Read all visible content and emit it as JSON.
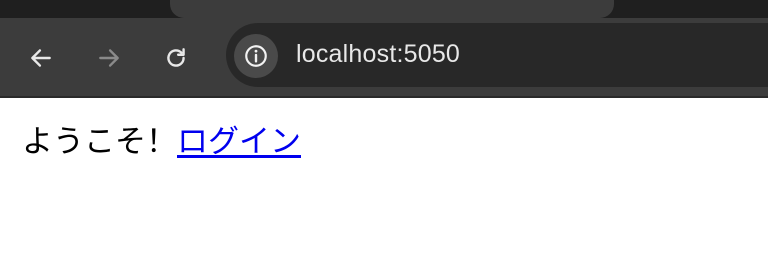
{
  "browser": {
    "address_bar": {
      "url": "localhost:5050"
    },
    "icons": {
      "back": "arrow-left-icon",
      "forward": "arrow-right-icon",
      "reload": "reload-icon",
      "site_info": "info-icon"
    },
    "colors": {
      "chrome_background": "#3c3c3c",
      "tab_strip": "#1f1f1f",
      "omnibox_background": "#282828",
      "icon_active": "#e8e8e8",
      "icon_disabled": "#8a8a8a"
    }
  },
  "page": {
    "greeting": "ようこそ！",
    "login_link": "ログイン",
    "colors": {
      "text": "#000000",
      "link": "#0000ee"
    }
  }
}
